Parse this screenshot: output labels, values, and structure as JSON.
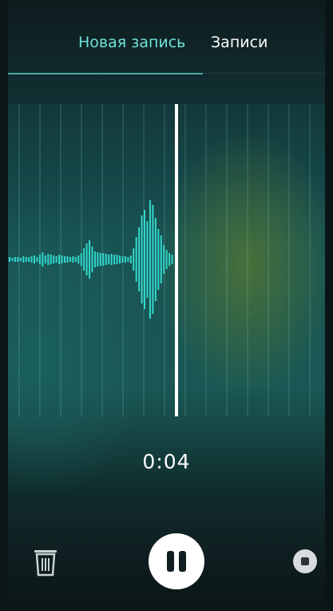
{
  "tabs": {
    "new_recording": "Новая запись",
    "recordings": "Записи",
    "active": "new_recording"
  },
  "recorder": {
    "elapsed_time": "0:04"
  },
  "controls": {
    "trash_icon": "trash-icon",
    "pause_icon": "pause-icon",
    "stop_icon": "stop-icon"
  },
  "colors": {
    "accent": "#6fe3da",
    "waveform": "#33d6cb",
    "playhead": "#ffffff"
  }
}
